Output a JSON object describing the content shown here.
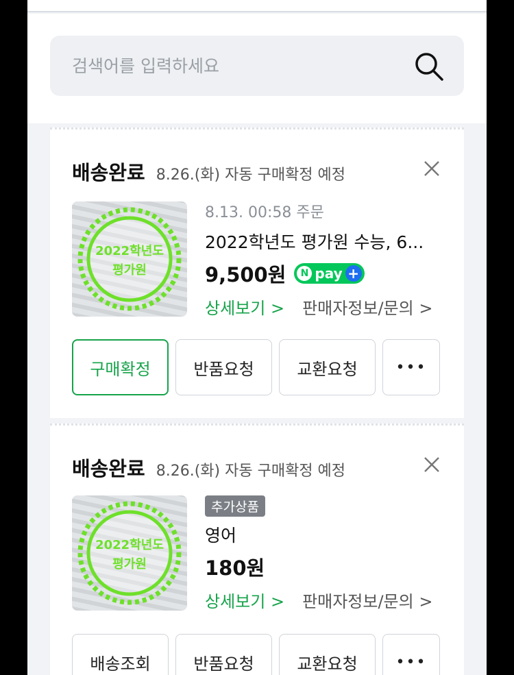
{
  "search": {
    "placeholder": "검색어를 입력하세요"
  },
  "orders": [
    {
      "status": "배송완료",
      "note": "8.26.(화) 자동 구매확정 예정",
      "thumb_text": [
        "2022학년도",
        "평가원"
      ],
      "meta": "8.13. 00:58 주문",
      "name": "2022학년도 평가원 수능, 6...",
      "price": "9,500원",
      "npay_label": "pay",
      "detail_link": "상세보기 >",
      "seller_link": "판매자정보/문의 >",
      "buttons": [
        "구매확정",
        "반품요청",
        "교환요청",
        "•••"
      ]
    },
    {
      "status": "배송완료",
      "note": "8.26.(화) 자동 구매확정 예정",
      "thumb_text": [
        "2022학년도",
        "평가원"
      ],
      "tag": "추가상품",
      "name": "영어",
      "price": "180원",
      "detail_link": "상세보기 >",
      "seller_link": "판매자정보/문의 >",
      "buttons": [
        "배송조회",
        "반품요청",
        "교환요청",
        "•••"
      ]
    }
  ],
  "colors": {
    "accent": "#16a34a",
    "npay": "#03c75a",
    "badge": "#6ee02a"
  }
}
